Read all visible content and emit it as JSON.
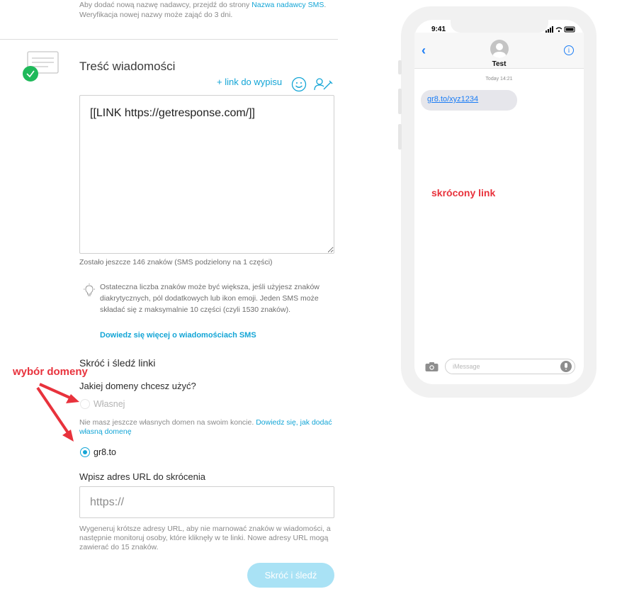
{
  "top_note": {
    "text": "Aby dodać nową nazwę nadawcy, przejdź do strony ",
    "link": "Nazwa nadawcy SMS",
    "text2": ". Weryfikacja nowej nazwy może zająć do 3 dni."
  },
  "message_section": {
    "title": "Treść wiadomości",
    "unsubscribe_link": "+ link do wypisu",
    "message_value": "[[LINK https://getresponse.com/]]",
    "char_count": "Zostało jeszcze 146 znaków (SMS podzielony na 1 części)",
    "info_text": "Ostateczna liczba znaków może być większa, jeśli użyjesz znaków diakrytycznych, pól dodatkowych lub ikon emoji. Jeden SMS może składać się z maksymalnie 10 części (czyli 1530 znaków).",
    "info_link": "Dowiedz się więcej o wiadomościach SMS"
  },
  "shorten_section": {
    "title": "Skróć i śledź linki",
    "domain_question": "Jakiej domeny chcesz użyć?",
    "option_own": "Własnej",
    "own_note": "Nie masz jeszcze własnych domen na swoim koncie. ",
    "own_note_link": "Dowiedz się, jak dodać własną domenę",
    "option_gr8": "gr8.to",
    "selected_domain": "gr8.to",
    "url_label": "Wpisz adres URL do skrócenia",
    "url_placeholder": "https://",
    "url_note": "Wygeneruj krótsze adresy URL, aby nie marnować znaków w wiadomości, a następnie monitoruj osoby, które kliknęły w te linki. Nowe adresy URL mogą zawierać do 15 znaków.",
    "button_label": "Skróć i śledź"
  },
  "annotations": {
    "domain_choice": "wybór domeny",
    "shortened_link": "skrócony link",
    "color": "#e8323c"
  },
  "phone": {
    "time": "9:41",
    "contact_name": "Test",
    "timestamp": "Today 14:21",
    "message_link": "gr8.to/xyz1234",
    "input_placeholder": "iMessage"
  },
  "colors": {
    "accent": "#13a5d6",
    "button_disabled": "#a9e2f5",
    "success": "#1fb95a",
    "ios_blue": "#1a7cf5"
  }
}
